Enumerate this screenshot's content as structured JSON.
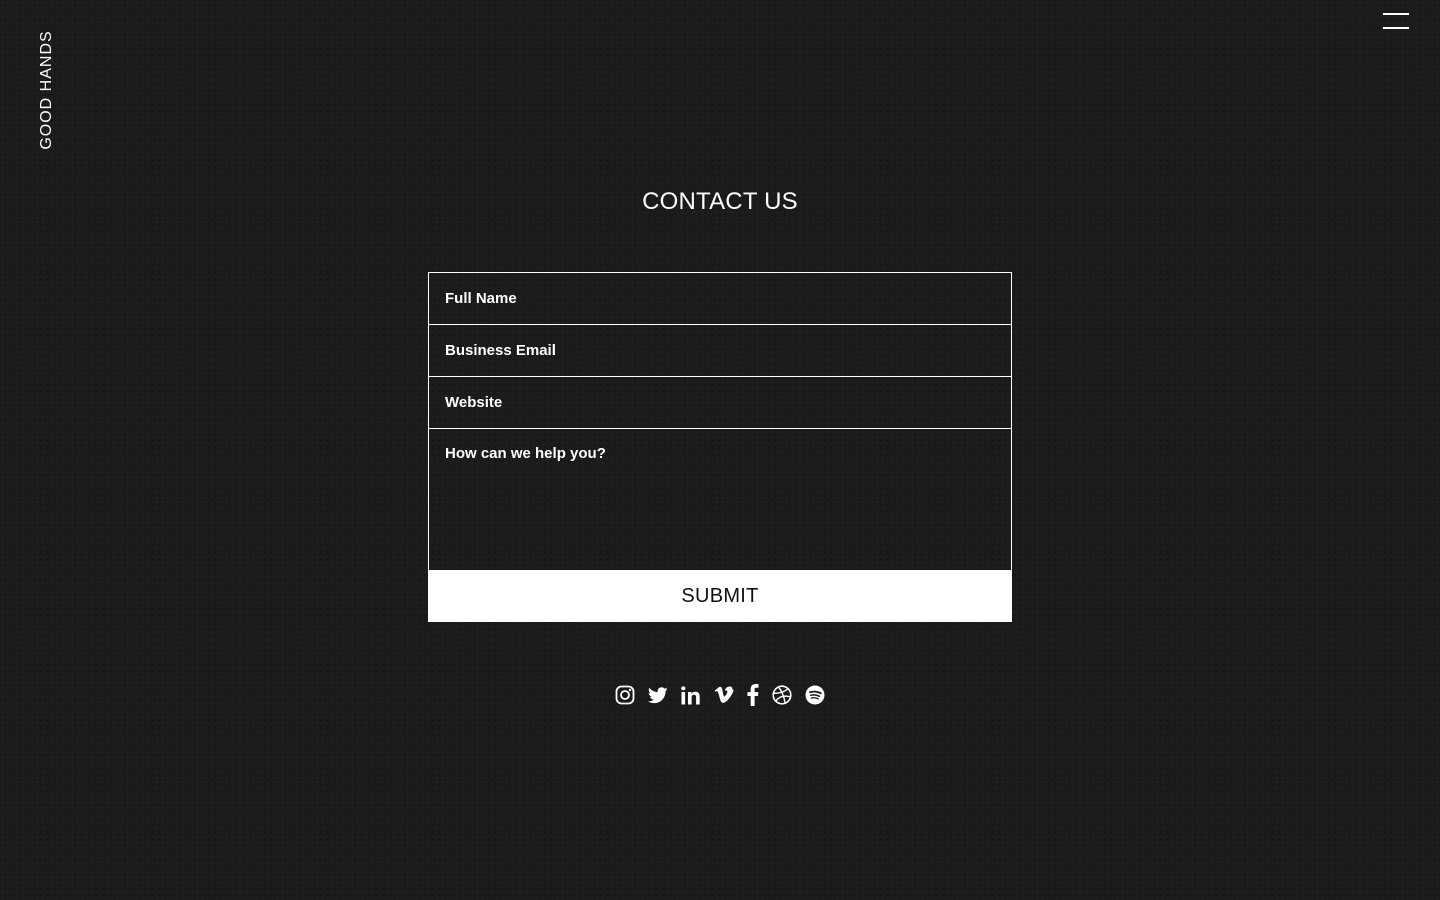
{
  "brand": {
    "name": "GOOD HANDS"
  },
  "header": {
    "menu_icon": "hamburger-menu-icon"
  },
  "contact": {
    "title": "CONTACT US",
    "fields": {
      "full_name": {
        "placeholder": "Full Name",
        "value": ""
      },
      "business_email": {
        "placeholder": "Business Email",
        "value": ""
      },
      "website": {
        "placeholder": "Website",
        "value": ""
      },
      "message": {
        "placeholder": "How can we help you?",
        "value": ""
      }
    },
    "submit_label": "SUBMIT"
  },
  "socials": [
    {
      "icon": "instagram-icon"
    },
    {
      "icon": "twitter-icon"
    },
    {
      "icon": "linkedin-icon"
    },
    {
      "icon": "vimeo-icon"
    },
    {
      "icon": "facebook-icon"
    },
    {
      "icon": "dribbble-icon"
    },
    {
      "icon": "spotify-icon"
    }
  ],
  "colors": {
    "background": "#1b1b1b",
    "foreground": "#ffffff",
    "button_text": "#111111"
  }
}
